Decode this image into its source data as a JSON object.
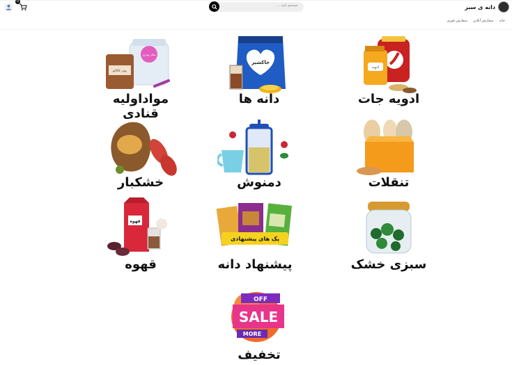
{
  "header": {
    "site_name": "دانه ی سبز",
    "search_placeholder": "جستجو کنید ...",
    "cart_count": "0",
    "nav": [
      "خانه",
      "سفارش آنلاین",
      "سفارش فوری"
    ]
  },
  "categories": [
    {
      "label": "ادویه جات",
      "icon": "spices-icon"
    },
    {
      "label": "دانه ها",
      "icon": "grains-icon"
    },
    {
      "label": "مواداولیه قنادی",
      "icon": "baking-supplies-icon"
    },
    {
      "label": "تنقلات",
      "icon": "snacks-icon"
    },
    {
      "label": "دمنوش",
      "icon": "herbal-tea-icon"
    },
    {
      "label": "خشکبار",
      "icon": "dried-fruit-icon"
    },
    {
      "label": "سبزی خشک",
      "icon": "dried-herbs-icon"
    },
    {
      "label": "پیشنهاد دانه",
      "icon": "offers-icon"
    },
    {
      "label": "قهوه",
      "icon": "coffee-icon"
    },
    {
      "label": "تخفیف",
      "icon": "sale-icon"
    }
  ],
  "badges": {
    "grains_bag": "خاکشیر",
    "offers_banner": "پک های پیشنهادی",
    "coffee_box": "قهوه",
    "spice_jar": "ادویه",
    "sale_top": "OFF",
    "sale_main": "SALE",
    "sale_bottom": "MORE",
    "baking_jar": "شکر پودری",
    "baking_bag": "پودر کاکائو"
  }
}
